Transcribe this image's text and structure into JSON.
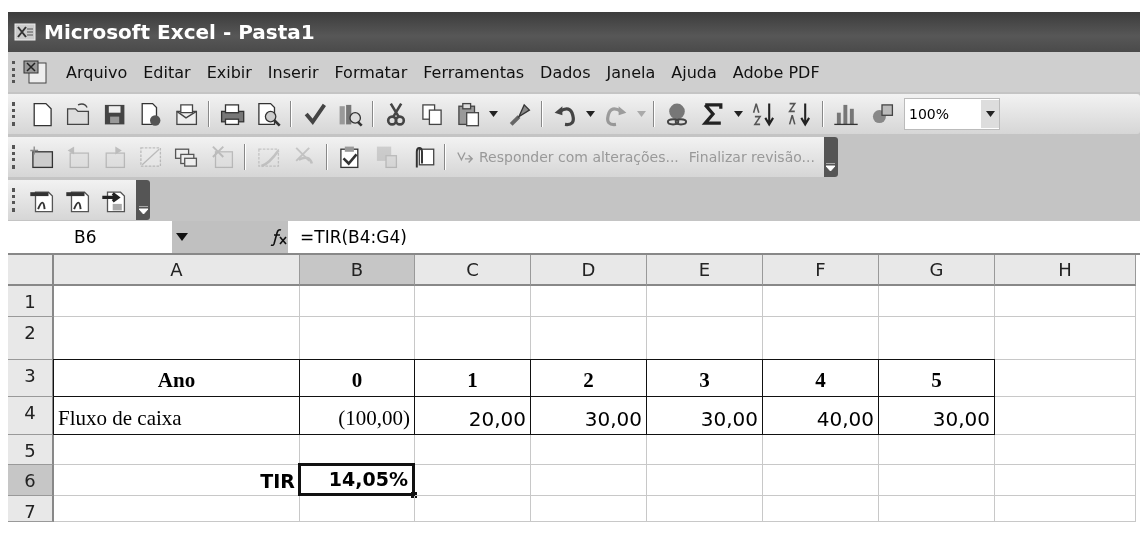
{
  "window": {
    "title": "Microsoft Excel - Pasta1"
  },
  "menu": [
    {
      "label": "Arquivo"
    },
    {
      "label": "Editar"
    },
    {
      "label": "Exibir"
    },
    {
      "label": "Inserir"
    },
    {
      "label": "Formatar"
    },
    {
      "label": "Ferramentas"
    },
    {
      "label": "Dados"
    },
    {
      "label": "Janela"
    },
    {
      "label": "Ajuda"
    },
    {
      "label": "Adobe PDF"
    }
  ],
  "toolbars": [
    {
      "items": [
        {
          "kind": "icon",
          "disabled": false
        },
        {
          "kind": "icon",
          "disabled": false
        },
        {
          "kind": "icon",
          "disabled": false
        },
        {
          "kind": "icon",
          "disabled": false
        },
        {
          "kind": "icon",
          "disabled": false
        },
        {
          "kind": "separator"
        },
        {
          "kind": "icon",
          "disabled": false
        },
        {
          "kind": "icon",
          "disabled": false
        },
        {
          "kind": "separator"
        },
        {
          "kind": "icon",
          "disabled": false
        },
        {
          "kind": "icon",
          "disabled": false
        },
        {
          "kind": "separator"
        },
        {
          "kind": "icon",
          "disabled": false
        },
        {
          "kind": "icon",
          "disabled": false
        },
        {
          "kind": "icon",
          "disabled": false
        },
        {
          "kind": "dropdown",
          "disabled": false
        },
        {
          "kind": "icon",
          "disabled": false
        },
        {
          "kind": "separator"
        },
        {
          "kind": "icon",
          "disabled": false
        },
        {
          "kind": "dropdown",
          "disabled": false
        },
        {
          "kind": "icon",
          "disabled": true
        },
        {
          "kind": "dropdown",
          "disabled": true
        },
        {
          "kind": "separator"
        },
        {
          "kind": "icon",
          "disabled": false
        },
        {
          "kind": "icon",
          "disabled": false
        },
        {
          "kind": "dropdown",
          "disabled": false
        },
        {
          "kind": "icon",
          "disabled": false
        },
        {
          "kind": "icon",
          "disabled": false
        },
        {
          "kind": "separator"
        },
        {
          "kind": "icon",
          "disabled": false
        },
        {
          "kind": "icon",
          "disabled": false
        },
        {
          "kind": "zoom",
          "value": "100%"
        }
      ]
    },
    {
      "items": [
        {
          "kind": "icon",
          "disabled": false
        },
        {
          "kind": "icon",
          "disabled": true
        },
        {
          "kind": "icon",
          "disabled": true
        },
        {
          "kind": "icon",
          "disabled": true
        },
        {
          "kind": "icon",
          "disabled": false
        },
        {
          "kind": "icon",
          "disabled": true
        },
        {
          "kind": "separator"
        },
        {
          "kind": "icon",
          "disabled": true
        },
        {
          "kind": "icon",
          "disabled": true
        },
        {
          "kind": "separator"
        },
        {
          "kind": "icon",
          "disabled": false
        },
        {
          "kind": "icon",
          "disabled": true
        },
        {
          "kind": "icon",
          "disabled": false
        },
        {
          "kind": "separator"
        },
        {
          "kind": "button",
          "label": "Responder com alterações...",
          "disabled": true
        },
        {
          "kind": "button",
          "label": "Finalizar revisão...",
          "disabled": true
        },
        {
          "kind": "handle"
        }
      ]
    },
    {
      "items": [
        {
          "kind": "icon",
          "disabled": false
        },
        {
          "kind": "icon",
          "disabled": false
        },
        {
          "kind": "icon",
          "disabled": false
        },
        {
          "kind": "handle"
        }
      ]
    }
  ],
  "formula_bar": {
    "name_box": "B6",
    "formula": "=TIR(B4:G4)"
  },
  "sheet": {
    "columns": [
      {
        "label": "A",
        "selected": false
      },
      {
        "label": "B",
        "selected": true
      },
      {
        "label": "C",
        "selected": false
      },
      {
        "label": "D",
        "selected": false
      },
      {
        "label": "E",
        "selected": false
      },
      {
        "label": "F",
        "selected": false
      },
      {
        "label": "G",
        "selected": false
      },
      {
        "label": "H",
        "selected": false
      }
    ],
    "rows": [
      {
        "label": "1",
        "selected": false,
        "cells": [
          {
            "selected": false
          },
          {
            "selected": false
          },
          {
            "selected": false
          },
          {
            "selected": false
          },
          {
            "selected": false
          },
          {
            "selected": false
          },
          {
            "selected": false
          },
          {
            "selected": false
          }
        ]
      },
      {
        "label": "2",
        "selected": false,
        "cells": [
          {
            "selected": false
          },
          {
            "selected": false
          },
          {
            "selected": false
          },
          {
            "selected": false
          },
          {
            "selected": false
          },
          {
            "selected": false
          },
          {
            "selected": false
          },
          {
            "selected": false
          }
        ]
      },
      {
        "label": "3",
        "selected": false,
        "cells": [
          {
            "kind": "heading",
            "text": "Ano",
            "bordered": true,
            "selected": false
          },
          {
            "kind": "heading",
            "text": "0",
            "bordered": true,
            "selected": false
          },
          {
            "kind": "heading",
            "text": "1",
            "bordered": true,
            "selected": false
          },
          {
            "kind": "heading",
            "text": "2",
            "bordered": true,
            "selected": false
          },
          {
            "kind": "heading",
            "text": "3",
            "bordered": true,
            "selected": false
          },
          {
            "kind": "heading",
            "text": "4",
            "bordered": true,
            "selected": false
          },
          {
            "kind": "heading",
            "text": "5",
            "bordered": true,
            "selected": false
          },
          {
            "selected": false
          }
        ]
      },
      {
        "label": "4",
        "selected": false,
        "cells": [
          {
            "kind": "text",
            "text": "Fluxo de caixa",
            "bordered": true,
            "selected": false
          },
          {
            "kind": "amount",
            "text": "(100,00)",
            "bordered": true,
            "selected": false
          },
          {
            "kind": "number",
            "text": "20,00",
            "bordered": true,
            "selected": false
          },
          {
            "kind": "number",
            "text": "30,00",
            "bordered": true,
            "selected": false
          },
          {
            "kind": "number",
            "text": "30,00",
            "bordered": true,
            "selected": false
          },
          {
            "kind": "number",
            "text": "40,00",
            "bordered": true,
            "selected": false
          },
          {
            "kind": "number",
            "text": "30,00",
            "bordered": true,
            "selected": false
          },
          {
            "selected": false
          }
        ]
      },
      {
        "label": "5",
        "selected": false,
        "cells": [
          {
            "selected": false
          },
          {
            "selected": false
          },
          {
            "selected": false
          },
          {
            "selected": false
          },
          {
            "selected": false
          },
          {
            "selected": false
          },
          {
            "selected": false
          },
          {
            "selected": false
          }
        ]
      },
      {
        "label": "6",
        "selected": true,
        "cells": [
          {
            "kind": "result",
            "text": "TIR",
            "selected": false
          },
          {
            "kind": "result",
            "text": "14,05%",
            "selected": true
          },
          {
            "selected": false
          },
          {
            "selected": false
          },
          {
            "selected": false
          },
          {
            "selected": false
          },
          {
            "selected": false
          },
          {
            "selected": false
          }
        ]
      },
      {
        "label": "7",
        "selected": false,
        "cells": [
          {
            "selected": false
          },
          {
            "selected": false
          },
          {
            "selected": false
          },
          {
            "selected": false
          },
          {
            "selected": false
          },
          {
            "selected": false
          },
          {
            "selected": false
          },
          {
            "selected": false
          }
        ]
      }
    ]
  }
}
